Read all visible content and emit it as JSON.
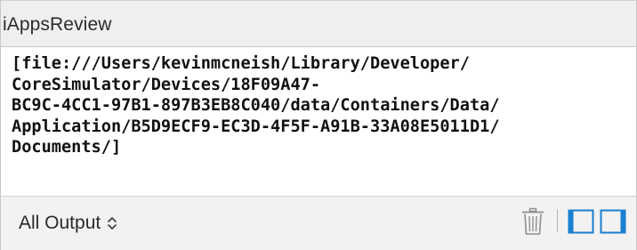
{
  "header": {
    "title": "iAppsReview"
  },
  "console": {
    "lines": [
      "[file:///Users/kevinmcneish/Library/Developer/",
      "CoreSimulator/Devices/18F09A47-",
      "BC9C-4CC1-97B1-897B3EB8C040/data/Containers/Data/",
      "Application/B5D9ECF9-EC3D-4F5F-A91B-33A08E5011D1/",
      "Documents/]"
    ]
  },
  "footer": {
    "output_filter": "All Output",
    "icons": {
      "filter_arrows": "chevron-up-down-icon",
      "clear": "trash-icon",
      "left_pane": "left-pane-toggle-icon",
      "right_pane": "right-pane-toggle-icon"
    }
  },
  "colors": {
    "accent": "#1a7fd0",
    "icon_gray": "#8e8e8e",
    "header_bg": "#efefef",
    "footer_bg": "#f2f2f2"
  }
}
